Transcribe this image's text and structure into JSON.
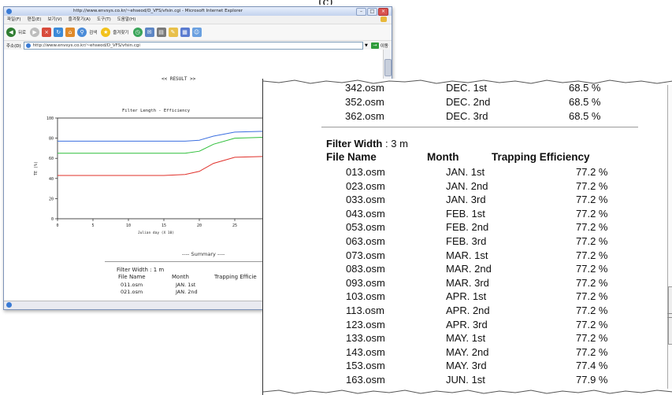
{
  "top_fragment": "(c)",
  "browser": {
    "title": "http://www.envsys.co.kr/~ehseod/D_VFS/vfsin.cgi - Microsoft Internet Explorer",
    "menu": [
      "파일(F)",
      "편집(E)",
      "보기(V)",
      "즐겨찾기(A)",
      "도구(T)",
      "도움말(H)"
    ],
    "toolbar": {
      "back_label": "뒤로",
      "search_label": "검색",
      "favorites_label": "즐겨찾기"
    },
    "address": {
      "label": "주소(D)",
      "url": "http://www.envsys.co.kr/~ehseod/D_VFS/vfsin.cgi",
      "go_label": "이동"
    }
  },
  "page": {
    "result_title": "<< RESULT >>",
    "summary_header": "---- Summary ----",
    "summary_filter_width": "Filter Width : 1 m",
    "summary_columns": [
      "File Name",
      "Month",
      "Trapping Efficie"
    ],
    "summary_rows": [
      {
        "file": "011.osm",
        "month": "JAN. 1st"
      },
      {
        "file": "021.osm",
        "month": "JAN. 2nd"
      }
    ]
  },
  "chart_data": {
    "type": "line",
    "title": "Filter Length - Efficiency",
    "xlabel": "Julian day (X 10)",
    "ylabel": "TE (%)",
    "xlim": [
      0,
      30
    ],
    "ylim": [
      0,
      100
    ],
    "x_ticks": [
      0,
      5,
      10,
      15,
      20,
      25
    ],
    "y_ticks": [
      0,
      20,
      40,
      60,
      80,
      100
    ],
    "grid": false,
    "series": [
      {
        "color": "#3b6fe0",
        "x": [
          0,
          5,
          10,
          15,
          18,
          20,
          22,
          25,
          30
        ],
        "y": [
          77,
          77,
          77,
          77,
          77,
          78,
          82,
          86,
          87
        ]
      },
      {
        "color": "#2fbf3a",
        "x": [
          0,
          5,
          10,
          15,
          18,
          20,
          22,
          25,
          30
        ],
        "y": [
          65,
          65,
          65,
          65,
          65,
          67,
          74,
          80,
          81
        ]
      },
      {
        "color": "#e0302a",
        "x": [
          0,
          5,
          10,
          15,
          18,
          20,
          22,
          25,
          30
        ],
        "y": [
          43,
          43,
          43,
          43,
          44,
          47,
          55,
          61,
          62
        ]
      }
    ]
  },
  "zoom": {
    "top_rows": [
      {
        "file": "342.osm",
        "month": "DEC. 1st",
        "te": "68.5 %"
      },
      {
        "file": "352.osm",
        "month": "DEC. 2nd",
        "te": "68.5 %"
      },
      {
        "file": "362.osm",
        "month": "DEC. 3rd",
        "te": "68.5 %"
      }
    ],
    "filter_width_label": "Filter Width",
    "filter_width_value": ": 3 m",
    "columns": [
      "File Name",
      "Month",
      "Trapping Efficiency"
    ],
    "rows": [
      {
        "file": "013.osm",
        "month": "JAN. 1st",
        "te": "77.2 %"
      },
      {
        "file": "023.osm",
        "month": "JAN. 2nd",
        "te": "77.2 %"
      },
      {
        "file": "033.osm",
        "month": "JAN. 3rd",
        "te": "77.2 %"
      },
      {
        "file": "043.osm",
        "month": "FEB. 1st",
        "te": "77.2 %"
      },
      {
        "file": "053.osm",
        "month": "FEB. 2nd",
        "te": "77.2 %"
      },
      {
        "file": "063.osm",
        "month": "FEB. 3rd",
        "te": "77.2 %"
      },
      {
        "file": "073.osm",
        "month": "MAR. 1st",
        "te": "77.2 %"
      },
      {
        "file": "083.osm",
        "month": "MAR. 2nd",
        "te": "77.2 %"
      },
      {
        "file": "093.osm",
        "month": "MAR. 3rd",
        "te": "77.2 %"
      },
      {
        "file": "103.osm",
        "month": "APR. 1st",
        "te": "77.2 %"
      },
      {
        "file": "113.osm",
        "month": "APR. 2nd",
        "te": "77.2 %"
      },
      {
        "file": "123.osm",
        "month": "APR. 3rd",
        "te": "77.2 %"
      },
      {
        "file": "133.osm",
        "month": "MAY. 1st",
        "te": "77.2 %"
      },
      {
        "file": "143.osm",
        "month": "MAY. 2nd",
        "te": "77.2 %"
      },
      {
        "file": "153.osm",
        "month": "MAY. 3rd",
        "te": "77.4 %"
      },
      {
        "file": "163.osm",
        "month": "JUN. 1st",
        "te": "77.9 %"
      }
    ]
  }
}
